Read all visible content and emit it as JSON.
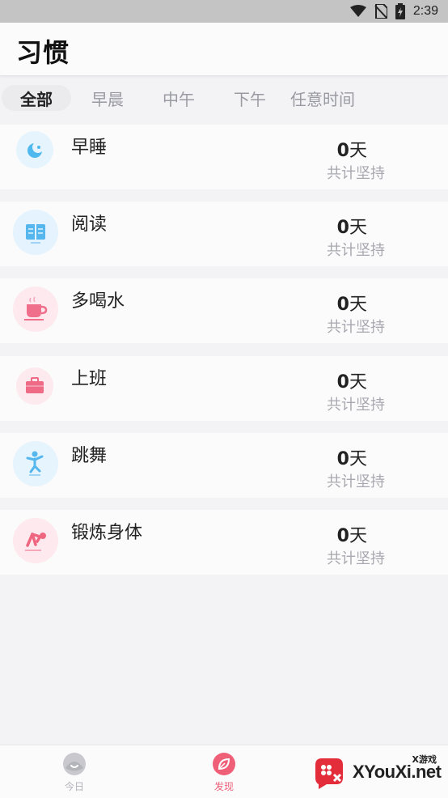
{
  "status_bar": {
    "time": "2:39"
  },
  "header": {
    "title": "习惯"
  },
  "tabs": [
    {
      "label": "全部",
      "active": true
    },
    {
      "label": "早晨",
      "active": false
    },
    {
      "label": "中午",
      "active": false
    },
    {
      "label": "下午",
      "active": false
    },
    {
      "label": "任意时间",
      "active": false
    }
  ],
  "habits": [
    {
      "name": "早睡",
      "days": "0",
      "unit": "天",
      "subtitle": "共计坚持",
      "icon": "moon-icon",
      "icon_bg": "#e6f4fd",
      "icon_color": "#4fb8ef"
    },
    {
      "name": "阅读",
      "days": "0",
      "unit": "天",
      "subtitle": "共计坚持",
      "icon": "book-icon",
      "icon_bg": "#e4f3fd",
      "icon_color": "#56b6ee"
    },
    {
      "name": "多喝水",
      "days": "0",
      "unit": "天",
      "subtitle": "共计坚持",
      "icon": "cup-icon",
      "icon_bg": "#fde9ee",
      "icon_color": "#f0708c"
    },
    {
      "name": "上班",
      "days": "0",
      "unit": "天",
      "subtitle": "共计坚持",
      "icon": "briefcase-icon",
      "icon_bg": "#fdeaee",
      "icon_color": "#ef6a85"
    },
    {
      "name": "跳舞",
      "days": "0",
      "unit": "天",
      "subtitle": "共计坚持",
      "icon": "dance-icon",
      "icon_bg": "#e6f4fd",
      "icon_color": "#56b6ee"
    },
    {
      "name": "锻炼身体",
      "days": "0",
      "unit": "天",
      "subtitle": "共计坚持",
      "icon": "exercise-icon",
      "icon_bg": "#fde9ee",
      "icon_color": "#ee667f"
    }
  ],
  "bottom_nav": [
    {
      "label": "今日",
      "icon": "today-icon",
      "active": false
    },
    {
      "label": "发现",
      "icon": "discover-icon",
      "active": true
    }
  ],
  "watermark": {
    "text": "XYouXi.net",
    "small": "X游戏"
  },
  "colors": {
    "accent": "#ef5f78",
    "inactive": "#b0b0b8"
  }
}
